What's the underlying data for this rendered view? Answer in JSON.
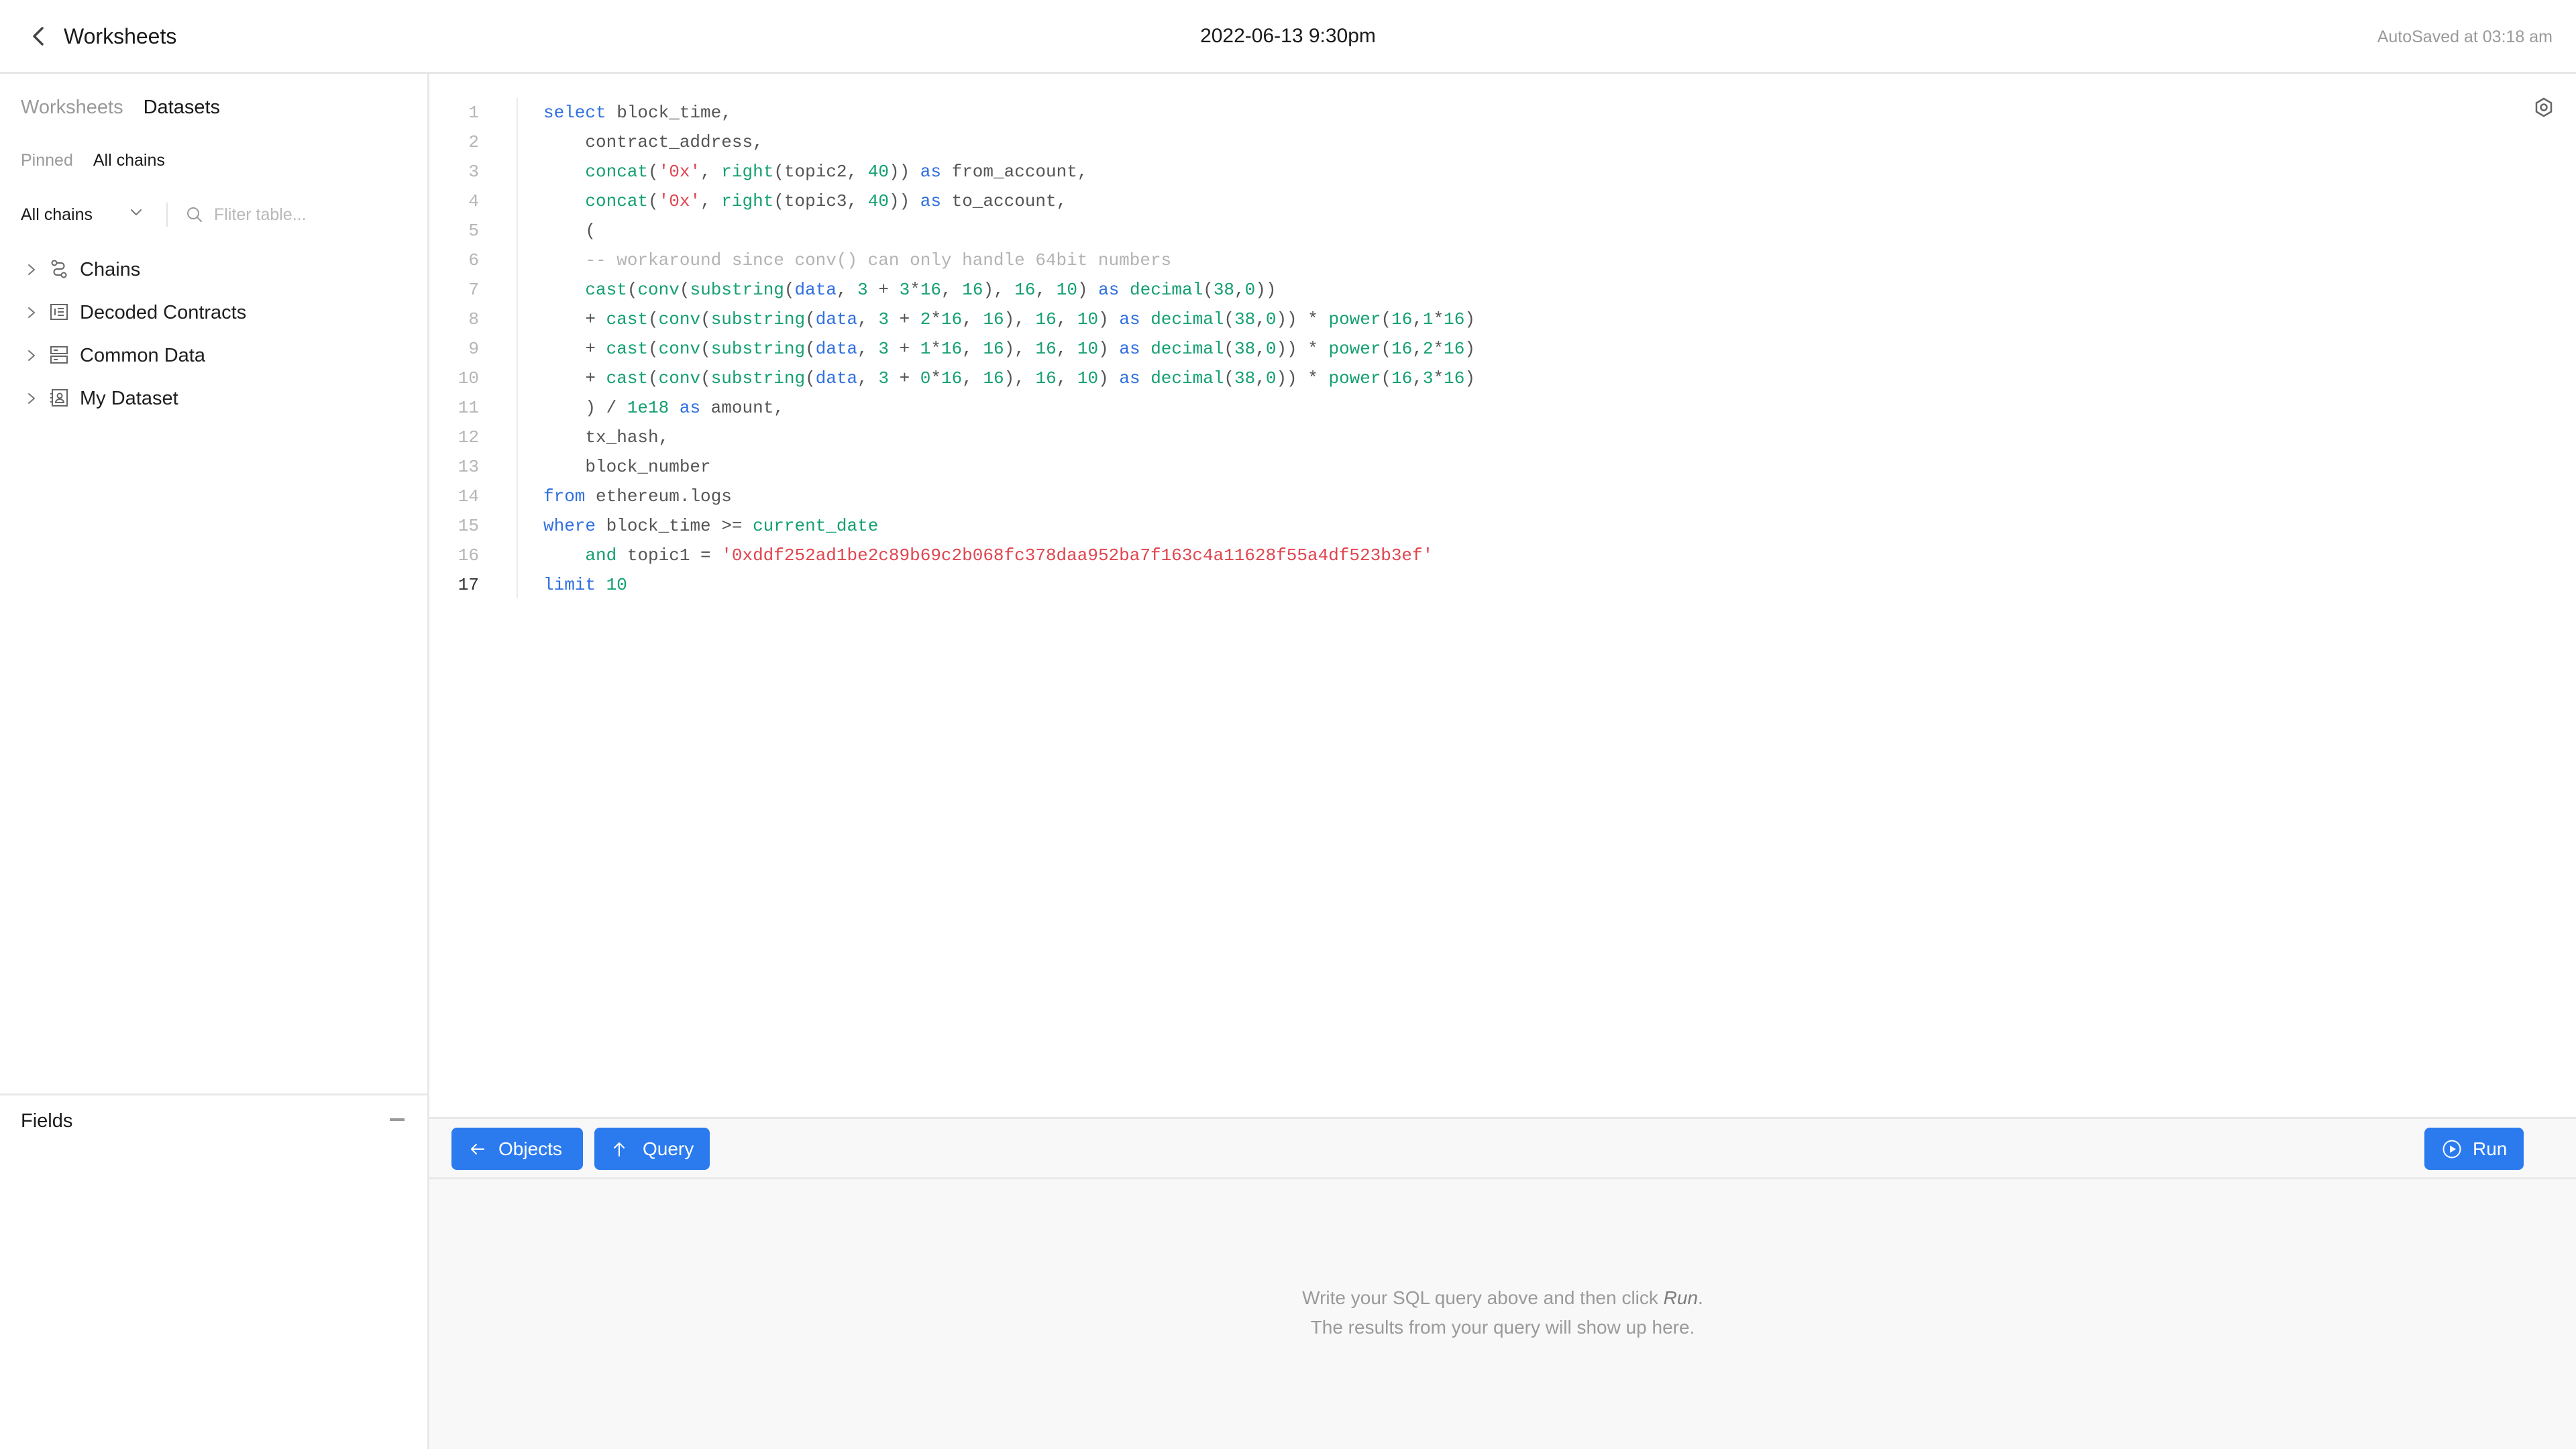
{
  "header": {
    "back_icon": "chevron-left-icon",
    "title": "Worksheets",
    "worksheet_name": "2022-06-13 9:30pm",
    "autosave": "AutoSaved at 03:18 am"
  },
  "sidebar": {
    "tabs": [
      {
        "label": "Worksheets",
        "active": false
      },
      {
        "label": "Datasets",
        "active": true
      }
    ],
    "sub_tabs": [
      {
        "label": "Pinned",
        "active": false
      },
      {
        "label": "All chains",
        "active": true
      }
    ],
    "chain_select": {
      "value": "All chains",
      "icon": "chevron-down-icon"
    },
    "filter": {
      "placeholder": "Fliter table...",
      "value": "",
      "icon": "search-icon"
    },
    "tree": [
      {
        "label": "Chains",
        "icon": "chains-icon"
      },
      {
        "label": "Decoded Contracts",
        "icon": "contract-list-icon"
      },
      {
        "label": "Common Data",
        "icon": "database-icon"
      },
      {
        "label": "My Dataset",
        "icon": "user-dataset-icon"
      }
    ],
    "fields": {
      "title": "Fields",
      "collapse_icon": "minus-icon"
    }
  },
  "editor": {
    "settings_icon": "settings-hexagon-icon",
    "current_line": 17,
    "lines": [
      {
        "n": "1",
        "tokens": [
          [
            "kw",
            "select"
          ],
          [
            "id",
            " block_time,"
          ]
        ]
      },
      {
        "n": "2",
        "tokens": [
          [
            "id",
            "    contract_address,"
          ]
        ]
      },
      {
        "n": "3",
        "tokens": [
          [
            "id",
            "    "
          ],
          [
            "fn",
            "concat"
          ],
          [
            "id",
            "("
          ],
          [
            "str",
            "'0x'"
          ],
          [
            "id",
            ", "
          ],
          [
            "fn",
            "right"
          ],
          [
            "id",
            "(topic2, "
          ],
          [
            "num",
            "40"
          ],
          [
            "id",
            ")) "
          ],
          [
            "kw",
            "as"
          ],
          [
            "id",
            " from_account,"
          ]
        ]
      },
      {
        "n": "4",
        "tokens": [
          [
            "id",
            "    "
          ],
          [
            "fn",
            "concat"
          ],
          [
            "id",
            "("
          ],
          [
            "str",
            "'0x'"
          ],
          [
            "id",
            ", "
          ],
          [
            "fn",
            "right"
          ],
          [
            "id",
            "(topic3, "
          ],
          [
            "num",
            "40"
          ],
          [
            "id",
            ")) "
          ],
          [
            "kw",
            "as"
          ],
          [
            "id",
            " to_account,"
          ]
        ]
      },
      {
        "n": "5",
        "tokens": [
          [
            "id",
            "    ("
          ]
        ]
      },
      {
        "n": "6",
        "tokens": [
          [
            "cm",
            "    -- workaround since conv() can only handle 64bit numbers"
          ]
        ]
      },
      {
        "n": "7",
        "tokens": [
          [
            "id",
            "    "
          ],
          [
            "fn",
            "cast"
          ],
          [
            "id",
            "("
          ],
          [
            "fn",
            "conv"
          ],
          [
            "id",
            "("
          ],
          [
            "fn",
            "substring"
          ],
          [
            "id",
            "("
          ],
          [
            "ref",
            "data"
          ],
          [
            "id",
            ", "
          ],
          [
            "num",
            "3"
          ],
          [
            "id",
            " + "
          ],
          [
            "num",
            "3"
          ],
          [
            "id",
            "*"
          ],
          [
            "num",
            "16"
          ],
          [
            "id",
            ", "
          ],
          [
            "num",
            "16"
          ],
          [
            "id",
            "), "
          ],
          [
            "num",
            "16"
          ],
          [
            "id",
            ", "
          ],
          [
            "num",
            "10"
          ],
          [
            "id",
            ") "
          ],
          [
            "kw",
            "as"
          ],
          [
            "id",
            " "
          ],
          [
            "fn",
            "decimal"
          ],
          [
            "id",
            "("
          ],
          [
            "num",
            "38"
          ],
          [
            "id",
            ","
          ],
          [
            "num",
            "0"
          ],
          [
            "id",
            "))"
          ]
        ]
      },
      {
        "n": "8",
        "tokens": [
          [
            "id",
            "    + "
          ],
          [
            "fn",
            "cast"
          ],
          [
            "id",
            "("
          ],
          [
            "fn",
            "conv"
          ],
          [
            "id",
            "("
          ],
          [
            "fn",
            "substring"
          ],
          [
            "id",
            "("
          ],
          [
            "ref",
            "data"
          ],
          [
            "id",
            ", "
          ],
          [
            "num",
            "3"
          ],
          [
            "id",
            " + "
          ],
          [
            "num",
            "2"
          ],
          [
            "id",
            "*"
          ],
          [
            "num",
            "16"
          ],
          [
            "id",
            ", "
          ],
          [
            "num",
            "16"
          ],
          [
            "id",
            "), "
          ],
          [
            "num",
            "16"
          ],
          [
            "id",
            ", "
          ],
          [
            "num",
            "10"
          ],
          [
            "id",
            ") "
          ],
          [
            "kw",
            "as"
          ],
          [
            "id",
            " "
          ],
          [
            "fn",
            "decimal"
          ],
          [
            "id",
            "("
          ],
          [
            "num",
            "38"
          ],
          [
            "id",
            ","
          ],
          [
            "num",
            "0"
          ],
          [
            "id",
            ")) * "
          ],
          [
            "fn",
            "power"
          ],
          [
            "id",
            "("
          ],
          [
            "num",
            "16"
          ],
          [
            "id",
            ","
          ],
          [
            "num",
            "1"
          ],
          [
            "id",
            "*"
          ],
          [
            "num",
            "16"
          ],
          [
            "id",
            ")"
          ]
        ]
      },
      {
        "n": "9",
        "tokens": [
          [
            "id",
            "    + "
          ],
          [
            "fn",
            "cast"
          ],
          [
            "id",
            "("
          ],
          [
            "fn",
            "conv"
          ],
          [
            "id",
            "("
          ],
          [
            "fn",
            "substring"
          ],
          [
            "id",
            "("
          ],
          [
            "ref",
            "data"
          ],
          [
            "id",
            ", "
          ],
          [
            "num",
            "3"
          ],
          [
            "id",
            " + "
          ],
          [
            "num",
            "1"
          ],
          [
            "id",
            "*"
          ],
          [
            "num",
            "16"
          ],
          [
            "id",
            ", "
          ],
          [
            "num",
            "16"
          ],
          [
            "id",
            "), "
          ],
          [
            "num",
            "16"
          ],
          [
            "id",
            ", "
          ],
          [
            "num",
            "10"
          ],
          [
            "id",
            ") "
          ],
          [
            "kw",
            "as"
          ],
          [
            "id",
            " "
          ],
          [
            "fn",
            "decimal"
          ],
          [
            "id",
            "("
          ],
          [
            "num",
            "38"
          ],
          [
            "id",
            ","
          ],
          [
            "num",
            "0"
          ],
          [
            "id",
            ")) * "
          ],
          [
            "fn",
            "power"
          ],
          [
            "id",
            "("
          ],
          [
            "num",
            "16"
          ],
          [
            "id",
            ","
          ],
          [
            "num",
            "2"
          ],
          [
            "id",
            "*"
          ],
          [
            "num",
            "16"
          ],
          [
            "id",
            ")"
          ]
        ]
      },
      {
        "n": "10",
        "tokens": [
          [
            "id",
            "    + "
          ],
          [
            "fn",
            "cast"
          ],
          [
            "id",
            "("
          ],
          [
            "fn",
            "conv"
          ],
          [
            "id",
            "("
          ],
          [
            "fn",
            "substring"
          ],
          [
            "id",
            "("
          ],
          [
            "ref",
            "data"
          ],
          [
            "id",
            ", "
          ],
          [
            "num",
            "3"
          ],
          [
            "id",
            " + "
          ],
          [
            "num",
            "0"
          ],
          [
            "id",
            "*"
          ],
          [
            "num",
            "16"
          ],
          [
            "id",
            ", "
          ],
          [
            "num",
            "16"
          ],
          [
            "id",
            "), "
          ],
          [
            "num",
            "16"
          ],
          [
            "id",
            ", "
          ],
          [
            "num",
            "10"
          ],
          [
            "id",
            ") "
          ],
          [
            "kw",
            "as"
          ],
          [
            "id",
            " "
          ],
          [
            "fn",
            "decimal"
          ],
          [
            "id",
            "("
          ],
          [
            "num",
            "38"
          ],
          [
            "id",
            ","
          ],
          [
            "num",
            "0"
          ],
          [
            "id",
            ")) * "
          ],
          [
            "fn",
            "power"
          ],
          [
            "id",
            "("
          ],
          [
            "num",
            "16"
          ],
          [
            "id",
            ","
          ],
          [
            "num",
            "3"
          ],
          [
            "id",
            "*"
          ],
          [
            "num",
            "16"
          ],
          [
            "id",
            ")"
          ]
        ]
      },
      {
        "n": "11",
        "tokens": [
          [
            "id",
            "    ) / "
          ],
          [
            "num",
            "1e18"
          ],
          [
            "id",
            " "
          ],
          [
            "kw",
            "as"
          ],
          [
            "id",
            " amount,"
          ]
        ]
      },
      {
        "n": "12",
        "tokens": [
          [
            "id",
            "    tx_hash,"
          ]
        ]
      },
      {
        "n": "13",
        "tokens": [
          [
            "id",
            "    block_number"
          ]
        ]
      },
      {
        "n": "14",
        "tokens": [
          [
            "kw",
            "from"
          ],
          [
            "id",
            " ethereum.logs"
          ]
        ]
      },
      {
        "n": "15",
        "tokens": [
          [
            "kw",
            "where"
          ],
          [
            "id",
            " block_time >= "
          ],
          [
            "fn",
            "current_date"
          ]
        ]
      },
      {
        "n": "16",
        "tokens": [
          [
            "id",
            "    "
          ],
          [
            "fn",
            "and"
          ],
          [
            "id",
            " topic1 = "
          ],
          [
            "str",
            "'0xddf252ad1be2c89b69c2b068fc378daa952ba7f163c4a11628f55a4df523b3ef'"
          ]
        ]
      },
      {
        "n": "17",
        "tokens": [
          [
            "kw",
            "limit"
          ],
          [
            "id",
            " "
          ],
          [
            "num",
            "10"
          ]
        ]
      }
    ]
  },
  "toolbar": {
    "objects_label": "Objects",
    "objects_icon": "arrow-left-icon",
    "query_label": "Query",
    "query_icon": "arrow-up-icon",
    "run_label": "Run",
    "run_icon": "play-circle-icon",
    "accent_color": "#2b7bef"
  },
  "results": {
    "empty_line1_prefix": "Write your SQL query above and then click ",
    "empty_line1_emph": "Run",
    "empty_line1_suffix": ".",
    "empty_line2": "The results from your query will show up here."
  }
}
